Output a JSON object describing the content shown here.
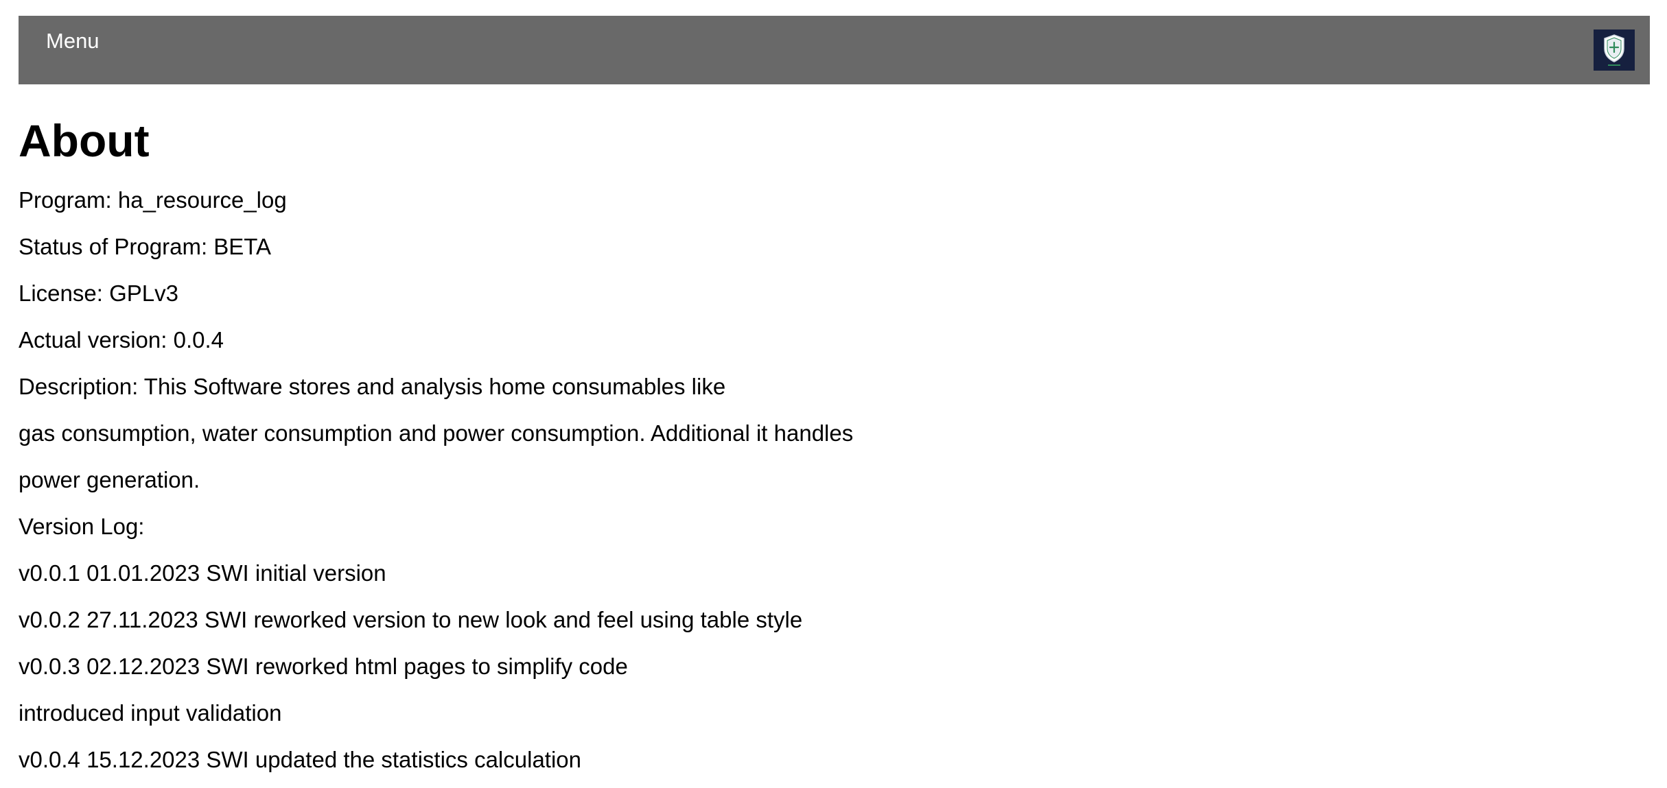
{
  "header": {
    "menu_label": "Menu",
    "logo_icon": "shield-logo-icon",
    "background_color": "#696969",
    "logo_background_color": "#16203f"
  },
  "main": {
    "title": "About",
    "lines": [
      "Program: ha_resource_log",
      "Status of Program: BETA",
      "License: GPLv3",
      "Actual version: 0.0.4",
      "Description: This Software stores and analysis home consumables like",
      "gas consumption, water consumption and power consumption. Additional it handles",
      "power generation.",
      "Version Log:",
      "v0.0.1 01.01.2023 SWI initial version",
      "v0.0.2 27.11.2023 SWI reworked version to new look and feel using table style",
      "v0.0.3 02.12.2023 SWI reworked html pages to simplify code",
      "introduced input validation",
      "v0.0.4 15.12.2023 SWI updated the statistics calculation"
    ]
  }
}
